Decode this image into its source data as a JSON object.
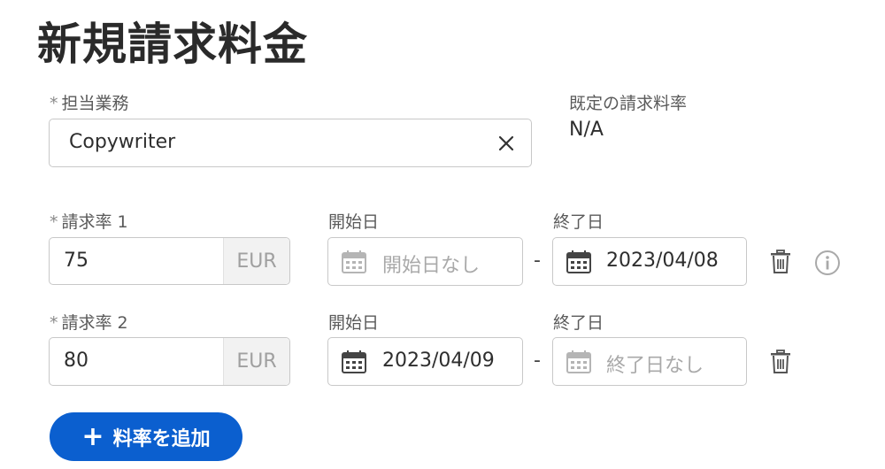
{
  "page": {
    "title": "新規請求料金"
  },
  "role": {
    "label": "担当業務",
    "required_marker": "*",
    "value": "Copywriter",
    "clear_icon": "close-icon"
  },
  "default_rate": {
    "label": "既定の請求料率",
    "value": "N/A"
  },
  "rates": [
    {
      "label": "請求率 1",
      "required_marker": "*",
      "amount": "75",
      "currency": "EUR",
      "start_label": "開始日",
      "start_value": "",
      "start_placeholder": "開始日なし",
      "separator": "-",
      "end_label": "終了日",
      "end_value": "2023/04/08",
      "end_placeholder": ""
    },
    {
      "label": "請求率 2",
      "required_marker": "*",
      "amount": "80",
      "currency": "EUR",
      "start_label": "開始日",
      "start_value": "2023/04/09",
      "start_placeholder": "",
      "separator": "-",
      "end_label": "終了日",
      "end_value": "",
      "end_placeholder": "終了日なし"
    }
  ],
  "add_button": {
    "label": "料率を追加",
    "icon": "plus-icon"
  },
  "colors": {
    "primary": "#0b5fcf",
    "border": "#c8c8c8",
    "placeholder": "#a9a9a9"
  }
}
